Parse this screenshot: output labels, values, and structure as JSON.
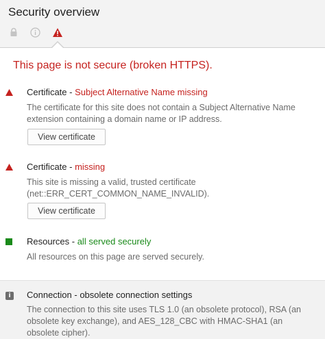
{
  "header": {
    "title": "Security overview",
    "tabs": [
      {
        "icon": "lock-icon"
      },
      {
        "icon": "info-icon"
      },
      {
        "icon": "warning-icon",
        "selected": true
      }
    ]
  },
  "summary": "This page is not secure (broken HTTPS).",
  "colors": {
    "error": "#c5221f",
    "secure": "#1a8a1a",
    "neutral": "#6e6e6e"
  },
  "sections": [
    {
      "title_prefix": "Certificate - ",
      "title_status": "Subject Alternative Name missing",
      "description": "The certificate for this site does not contain a Subject Alternative Name extension containing a domain name or IP address.",
      "button": "View certificate"
    },
    {
      "title_prefix": "Certificate - ",
      "title_status": "missing",
      "description": "This site is missing a valid, trusted certificate (net::ERR_CERT_COMMON_NAME_INVALID).",
      "button": "View certificate"
    },
    {
      "title_prefix": "Resources - ",
      "title_status": "all served securely",
      "description": "All resources on this page are served securely."
    },
    {
      "title": "Connection - obsolete connection settings",
      "description": "The connection to this site uses TLS 1.0 (an obsolete protocol), RSA (an obsolete key exchange), and AES_128_CBC with HMAC-SHA1 (an obsolete cipher)."
    }
  ]
}
